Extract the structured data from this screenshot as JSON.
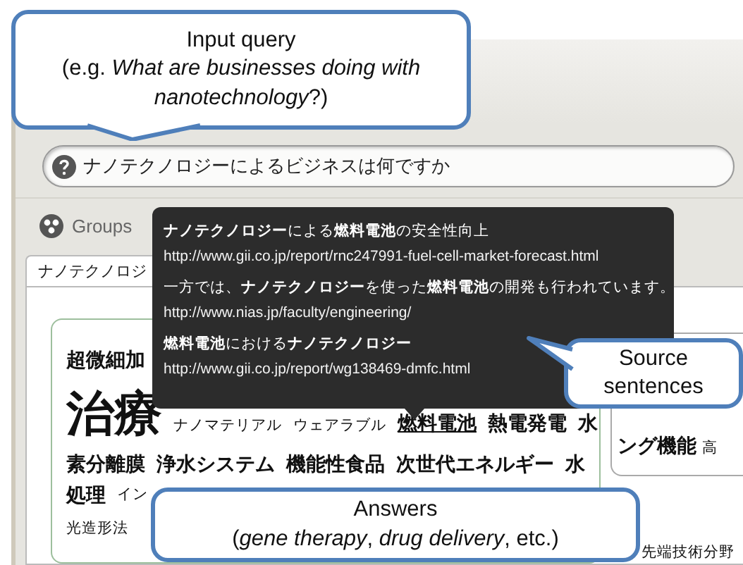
{
  "callouts": [
    {
      "kind": "query",
      "title": "Input query",
      "body": "(e.g. *What are businesses doing with nanotechnology*?)"
    },
    {
      "kind": "sources",
      "title": "Source sentences"
    },
    {
      "kind": "answers",
      "title": "Answers",
      "body": "(*gene therapy*, *drug delivery*, etc.)"
    }
  ],
  "search": {
    "value": "ナノテクノロジーによるビジネスは何ですか"
  },
  "groups_button": "Groups",
  "tabs": [
    {
      "label": "ナノテクノロジ",
      "selected": true
    }
  ],
  "answer_cloud": {
    "lines": [
      [
        {
          "text": "超微細加",
          "kind": "bold",
          "selected": false
        }
      ],
      [
        {
          "text": "治療",
          "kind": "large",
          "selected": false
        },
        {
          "text": "ナノマテリアル",
          "kind": "small",
          "selected": false
        },
        {
          "text": "ウェアラブル",
          "kind": "small",
          "selected": false
        },
        {
          "text": "燃料電池",
          "kind": "bold",
          "selected": true
        },
        {
          "text": "熱電発電",
          "kind": "bold",
          "selected": false
        },
        {
          "text": "水",
          "kind": "bold",
          "selected": false
        }
      ],
      [
        {
          "text": "素分離膜",
          "kind": "bold",
          "selected": false
        },
        {
          "text": "浄水システム",
          "kind": "bold",
          "selected": false
        },
        {
          "text": "機能性食品",
          "kind": "bold",
          "selected": false
        },
        {
          "text": "次世代エネルギー",
          "kind": "bold",
          "selected": false
        },
        {
          "text": "水",
          "kind": "bold",
          "selected": false
        }
      ],
      [
        {
          "text": "処理",
          "kind": "bold",
          "selected": false
        },
        {
          "text": "イン",
          "kind": "small",
          "selected": false
        }
      ],
      [
        {
          "text": "光造形法",
          "kind": "small",
          "selected": false
        }
      ]
    ]
  },
  "side_card": {
    "words": [
      {
        "text": "ング機能",
        "kind": "bold",
        "selected": false
      },
      {
        "text": "高",
        "kind": "small",
        "selected": false
      }
    ]
  },
  "side_footer": [
    {
      "text": "先端技術分野",
      "kind": "small",
      "selected": false
    }
  ],
  "tooltip": {
    "sentences": [
      {
        "text": "**ナノテクノロジー**による**燃料電池**の安全性向上",
        "url": "http://www.gii.co.jp/report/rnc247991-fuel-cell-market-forecast.html"
      },
      {
        "text": "一方では、**ナノテクノロジー**を使った**燃料電池**の開発も行われています。",
        "url": "http://www.nias.jp/faculty/engineering/"
      },
      {
        "text": "**燃料電池**における**ナノテクノロジー**",
        "url": "http://www.gii.co.jp/report/wg138469-dmfc.html"
      }
    ]
  }
}
